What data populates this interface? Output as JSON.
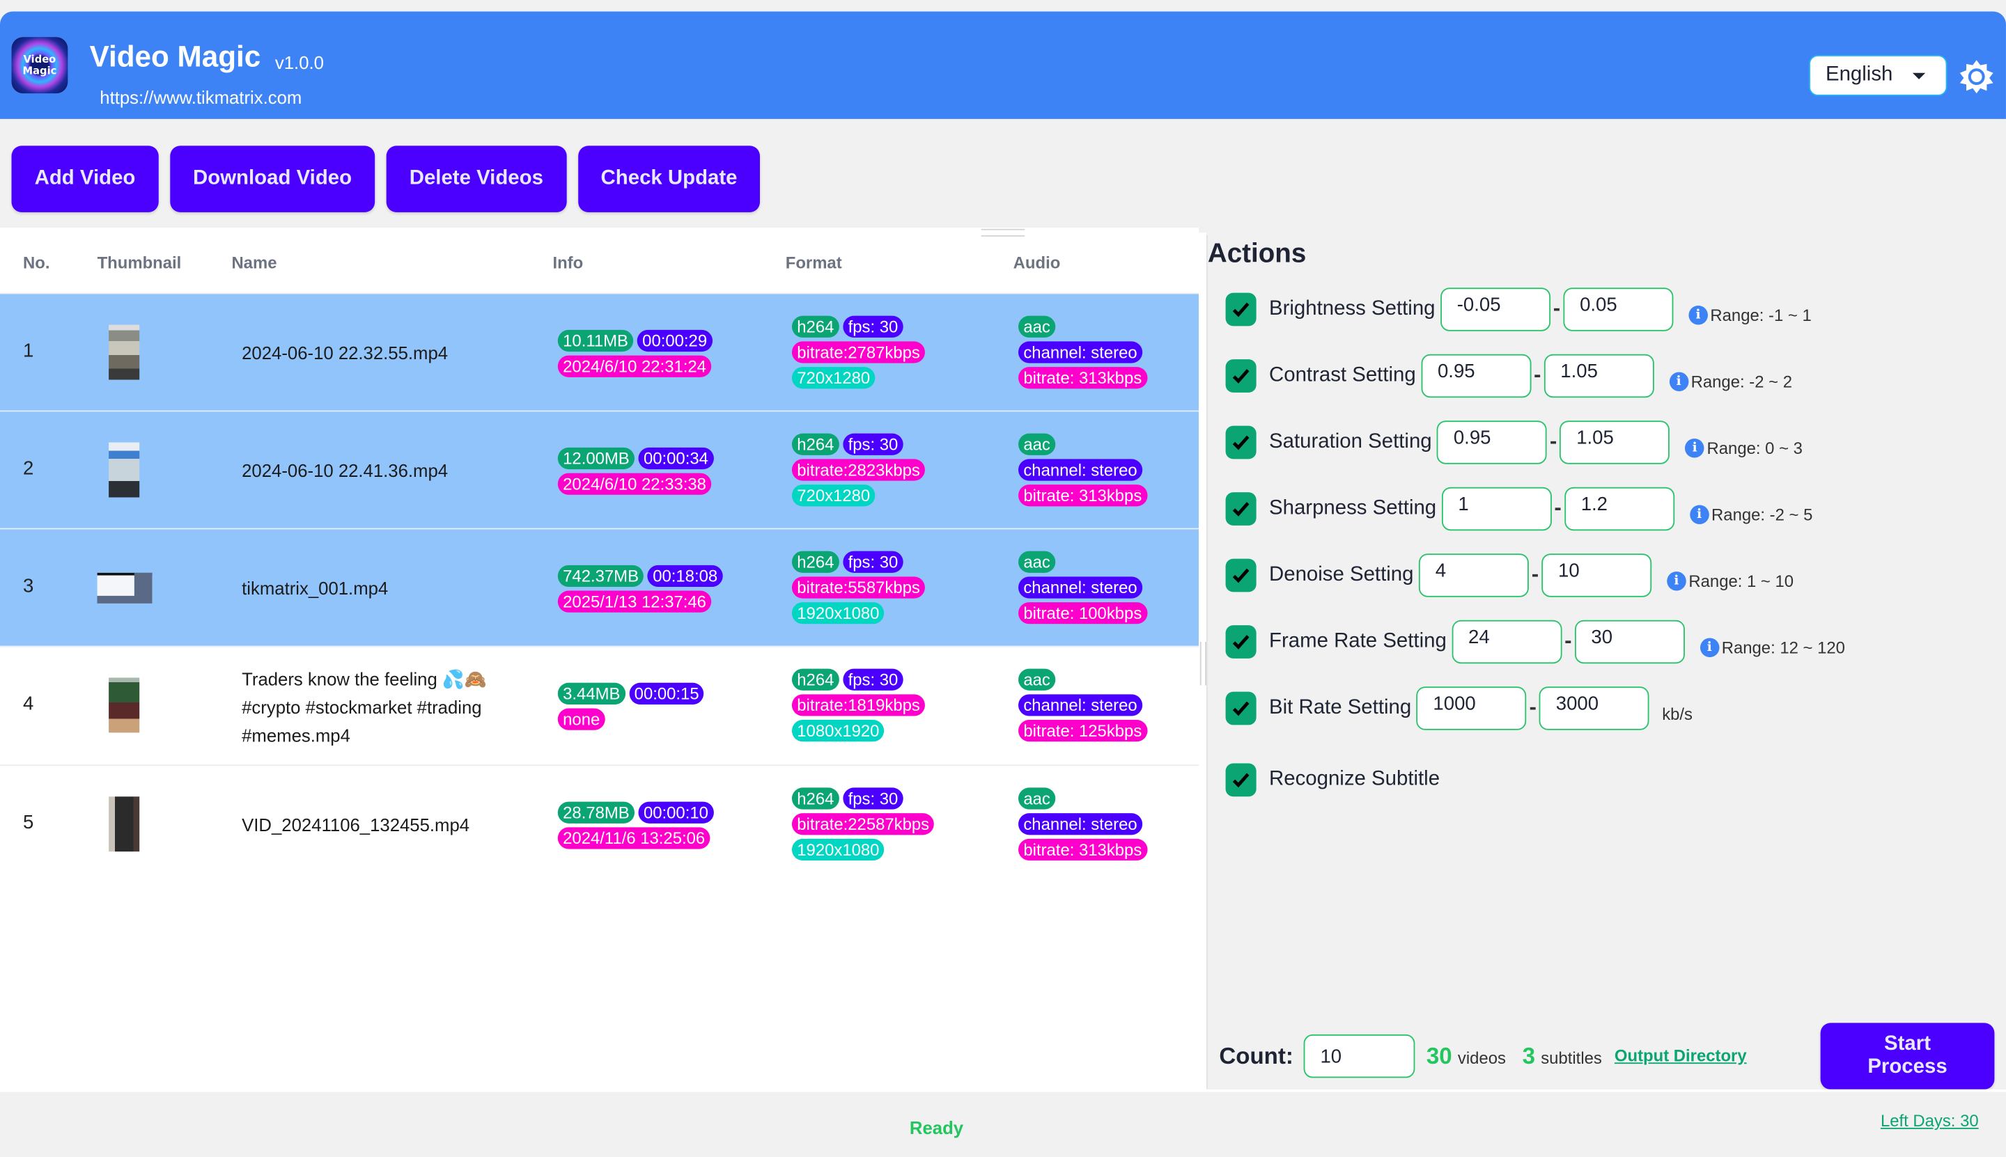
{
  "app": {
    "logo_text": "Video Magic",
    "title": "Video Magic",
    "version": "v1.0.0",
    "url": "https://www.tikmatrix.com",
    "language": "English"
  },
  "toolbar": {
    "add_video": "Add Video",
    "download_video": "Download Video",
    "delete_videos": "Delete Videos",
    "check_update": "Check Update"
  },
  "table": {
    "headers": {
      "no": "No.",
      "thumbnail": "Thumbnail",
      "name": "Name",
      "info": "Info",
      "format": "Format",
      "audio": "Audio"
    },
    "rows": [
      {
        "no": "1",
        "selected": true,
        "thumbnail_desc": "portrait screenshot of video grid",
        "name": "2024-06-10 22.32.55.mp4",
        "size": "10.11MB",
        "duration": "00:00:29",
        "created": "2024/6/10 22:31:24",
        "codec": "h264",
        "fps": "fps: 30",
        "bitrate": "bitrate:2787kbps",
        "resolution": "720x1280",
        "audio_codec": "aac",
        "channel": "channel: stereo",
        "audio_bitrate": "bitrate: 313kbps"
      },
      {
        "no": "2",
        "selected": true,
        "thumbnail_desc": "portrait phone screen",
        "name": "2024-06-10 22.41.36.mp4",
        "size": "12.00MB",
        "duration": "00:00:34",
        "created": "2024/6/10 22:33:38",
        "codec": "h264",
        "fps": "fps: 30",
        "bitrate": "bitrate:2823kbps",
        "resolution": "720x1280",
        "audio_codec": "aac",
        "channel": "channel: stereo",
        "audio_bitrate": "bitrate: 313kbps"
      },
      {
        "no": "3",
        "selected": true,
        "thumbnail_desc": "landscape website screenshot",
        "name": "tikmatrix_001.mp4",
        "size": "742.37MB",
        "duration": "00:18:08",
        "created": "2025/1/13 12:37:46",
        "codec": "h264",
        "fps": "fps: 30",
        "bitrate": "bitrate:5587kbps",
        "resolution": "1920x1080",
        "audio_codec": "aac",
        "channel": "channel: stereo",
        "audio_bitrate": "bitrate: 100kbps"
      },
      {
        "no": "4",
        "selected": false,
        "thumbnail_desc": "monitor with trading chart",
        "name": "Traders know the feeling 💦🙈 #crypto #stockmarket #trading #memes.mp4",
        "size": "3.44MB",
        "duration": "00:00:15",
        "created": "none",
        "codec": "h264",
        "fps": "fps: 30",
        "bitrate": "bitrate:1819kbps",
        "resolution": "1080x1920",
        "audio_codec": "aac",
        "channel": "channel: stereo",
        "audio_bitrate": "bitrate: 125kbps"
      },
      {
        "no": "5",
        "selected": false,
        "thumbnail_desc": "dark electronic device",
        "name": "VID_20241106_132455.mp4",
        "size": "28.78MB",
        "duration": "00:00:10",
        "created": "2024/11/6 13:25:06",
        "codec": "h264",
        "fps": "fps: 30",
        "bitrate": "bitrate:22587kbps",
        "resolution": "1920x1080",
        "audio_codec": "aac",
        "channel": "channel: stereo",
        "audio_bitrate": "bitrate: 313kbps"
      }
    ]
  },
  "actions": {
    "title": "Actions",
    "settings": [
      {
        "label": "Brightness Setting",
        "checked": true,
        "min": "-0.05",
        "max": "0.05",
        "range": "Range: -1 ~ 1"
      },
      {
        "label": "Contrast Setting",
        "checked": true,
        "min": "0.95",
        "max": "1.05",
        "range": "Range: -2 ~ 2"
      },
      {
        "label": "Saturation Setting",
        "checked": true,
        "min": "0.95",
        "max": "1.05",
        "range": "Range: 0 ~ 3"
      },
      {
        "label": "Sharpness Setting",
        "checked": true,
        "min": "1",
        "max": "1.2",
        "range": "Range: -2 ~ 5"
      },
      {
        "label": "Denoise Setting",
        "checked": true,
        "min": "4",
        "max": "10",
        "range": "Range: 1 ~ 10"
      },
      {
        "label": "Frame Rate Setting",
        "checked": true,
        "min": "24",
        "max": "30",
        "range": "Range: 12 ~ 120"
      },
      {
        "label": "Bit Rate Setting",
        "checked": true,
        "min": "1000",
        "max": "3000",
        "unit": "kb/s"
      },
      {
        "label": "Recognize Subtitle",
        "checked": true
      }
    ],
    "dash": "-",
    "info_glyph": "i",
    "count_label": "Count:",
    "count_value": "10",
    "videos_count": "30",
    "videos_label": "videos",
    "subtitles_count": "3",
    "subtitles_label": "subtitles",
    "output_directory": "Output Directory",
    "start_process": "Start Process"
  },
  "status": {
    "text": "Ready",
    "left_days": "Left Days: 30"
  },
  "colors": {
    "header_bg": "#3d83f5",
    "button_bg": "#4b00ff",
    "selected_row": "#91c4fb",
    "badge_green": "#0ba573",
    "badge_purple": "#4b00ff",
    "badge_magenta": "#ff00cc",
    "badge_teal": "#00d6c1",
    "status_green": "#22c55e"
  }
}
